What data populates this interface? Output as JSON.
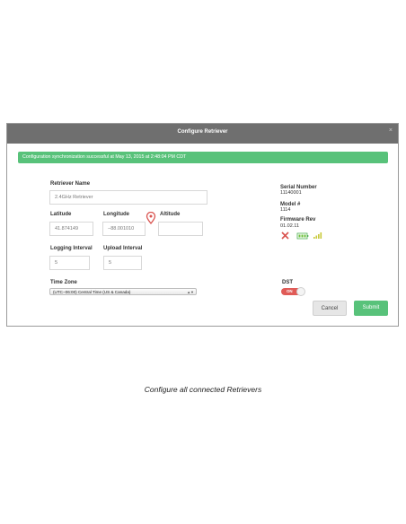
{
  "dialog": {
    "title": "Configure Retriever",
    "close_label": "×",
    "alert": "Configuration synchronization successful at May 13, 2015 at 2:48:04 PM CDT"
  },
  "form": {
    "retriever_name": {
      "label": "Retriever Name",
      "value": "2.4GHz Retriever"
    },
    "latitude": {
      "label": "Latitude",
      "value": "41.874149"
    },
    "longitude": {
      "label": "Longitude",
      "value": "−88.001010"
    },
    "altitude": {
      "label": "Altitude",
      "value": ""
    },
    "logging_interval": {
      "label": "Logging Interval",
      "value": "5"
    },
    "upload_interval": {
      "label": "Upload Interval",
      "value": "5"
    },
    "time_zone": {
      "label": "Time Zone",
      "value": "(UTC−06:00) Central Time (US & Canada)"
    }
  },
  "info": {
    "serial_label": "Serial Number",
    "serial_value": "11140001",
    "model_label": "Model #",
    "model_value": "1114",
    "firmware_label": "Firmware Rev",
    "firmware_value": "01.02.11",
    "status_icons": [
      "x-icon",
      "battery-icon",
      "signal-icon"
    ],
    "dst_label": "DST",
    "dst_toggle_text": "ON"
  },
  "buttons": {
    "cancel": "Cancel",
    "submit": "Submit"
  },
  "caption": "Configure all connected Retrievers",
  "colors": {
    "accent_green": "#58c27a",
    "titlebar": "#6f6f6f",
    "toggle_red": "#e05b57"
  }
}
